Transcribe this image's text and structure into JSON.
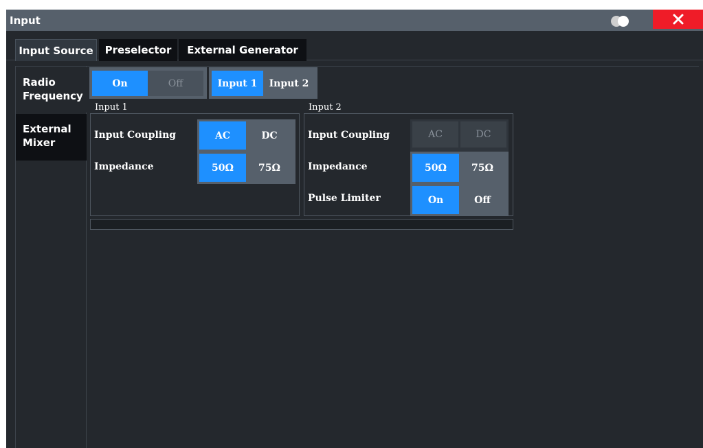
{
  "window": {
    "title": "Input",
    "close_icon": "close-icon",
    "theme_toggle_icon": "theme-toggle-icon",
    "colors": {
      "accent": "#1e90ff",
      "close": "#ef1c28",
      "titlebar": "#56606b",
      "background": "#24282d"
    }
  },
  "tabs": [
    {
      "label": "Input Source",
      "active": true
    },
    {
      "label": "Preselector",
      "active": false
    },
    {
      "label": "External Generator",
      "active": false
    }
  ],
  "sidenav": [
    {
      "label": "Radio Frequency",
      "active": true
    },
    {
      "label": "External Mixer",
      "active": false
    }
  ],
  "rf_state": {
    "on_label": "On",
    "off_label": "Off",
    "selected": "On"
  },
  "input_select": {
    "options": [
      "Input 1",
      "Input 2"
    ],
    "selected": "Input 1"
  },
  "input1": {
    "group_label": "Input 1",
    "coupling": {
      "label": "Input Coupling",
      "options": [
        "AC",
        "DC"
      ],
      "selected": "AC"
    },
    "impedance": {
      "label": "Impedance",
      "options": [
        "50Ω",
        "75Ω"
      ],
      "selected": "50Ω"
    }
  },
  "input2": {
    "group_label": "Input 2",
    "coupling": {
      "label": "Input Coupling",
      "options": [
        "AC",
        "DC"
      ],
      "selected": "",
      "enabled": false
    },
    "impedance": {
      "label": "Impedance",
      "options": [
        "50Ω",
        "75Ω"
      ],
      "selected": "50Ω"
    },
    "pulse_limiter": {
      "label": "Pulse Limiter",
      "options": [
        "On",
        "Off"
      ],
      "selected": "On"
    }
  }
}
